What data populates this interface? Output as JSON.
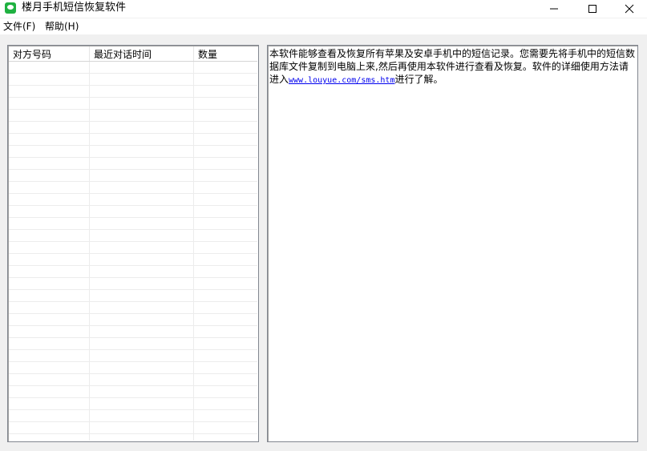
{
  "window": {
    "title": "楼月手机短信恢复软件",
    "icon": "chat-bubble-icon",
    "accent": "#1fb141"
  },
  "menu": {
    "file": "文件(F)",
    "help": "帮助(H)"
  },
  "list": {
    "columns": [
      "对方号码",
      "最近对话时间",
      "数量"
    ]
  },
  "info": {
    "text_before": "本软件能够查看及恢复所有苹果及安卓手机中的短信记录。您需要先将手机中的短信数据库文件复制到电脑上来,然后再使用本软件进行查看及恢复。软件的详细使用方法请进入",
    "link": "www.louyue.com/sms.htm",
    "text_after": "进行了解。",
    "link_color": "#0000ee"
  }
}
